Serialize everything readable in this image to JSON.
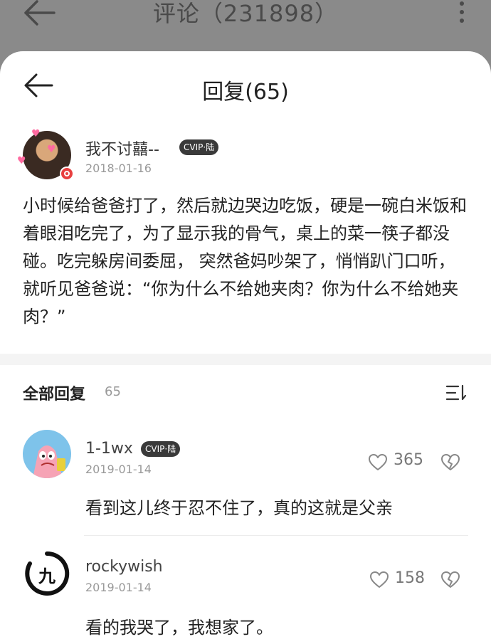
{
  "background_header": {
    "title": "评论（231898）"
  },
  "sheet": {
    "title": "回复(65)"
  },
  "original_comment": {
    "username": "我不讨囍--",
    "vip_badge": "CVIP·陆",
    "date": "2018-01-16",
    "text": "小时候给爸爸打了，然后就边哭边吃饭，硬是一碗白米饭和着眼泪吃完了，为了显示我的骨气，桌上的菜一筷子都没碰。吃完躲房间委屈， 突然爸妈吵架了，悄悄趴门口听，就听见爸爸说：“你为什么不给她夹肉？你为什么不给她夹肉？”"
  },
  "replies_section": {
    "label": "全部回复",
    "count": "65"
  },
  "replies": [
    {
      "username": "1-1wx",
      "vip_badge": "CVIP·陆",
      "date": "2019-01-14",
      "likes": "365",
      "text": "看到这儿终于忍不住了，真的这就是父亲"
    },
    {
      "username": "rockywish",
      "date": "2019-01-14",
      "likes": "158",
      "text": "看的我哭了，我想家了。",
      "avatar_glyph": "九"
    }
  ],
  "colors": {
    "overlay": "#8a8a8a",
    "sheet": "#ffffff",
    "vip_badge_bg": "#3a3a3a",
    "badge_red": "#e84040"
  },
  "icons": [
    "back-arrow-icon",
    "more-vertical-icon",
    "sort-icon",
    "heart-outline-icon",
    "dislike-heart-icon"
  ]
}
